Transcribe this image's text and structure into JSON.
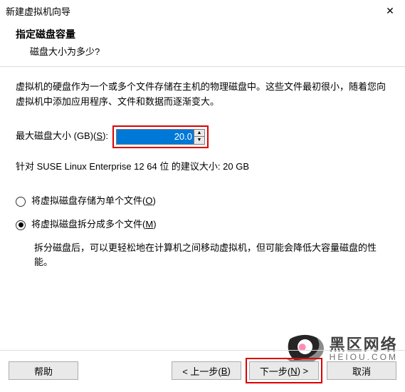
{
  "window": {
    "title": "新建虚拟机向导",
    "close": "✕"
  },
  "header": {
    "title": "指定磁盘容量",
    "sub": "磁盘大小为多少?"
  },
  "desc": "虚拟机的硬盘作为一个或多个文件存储在主机的物理磁盘中。这些文件最初很小，随着您向虚拟机中添加应用程序、文件和数据而逐渐变大。",
  "size": {
    "label_pre": "最大磁盘大小 (GB)(",
    "label_hk": "S",
    "label_post": "):",
    "value": "20.0",
    "spin_up": "▲",
    "spin_down": "▼"
  },
  "recommend": "针对 SUSE Linux Enterprise 12 64 位 的建议大小: 20 GB",
  "radios": {
    "single": {
      "label_pre": "将虚拟磁盘存储为单个文件(",
      "hk": "O",
      "label_post": ")"
    },
    "split": {
      "label_pre": "将虚拟磁盘拆分成多个文件(",
      "hk": "M",
      "label_post": ")"
    },
    "note": "拆分磁盘后，可以更轻松地在计算机之间移动虚拟机，但可能会降低大容量磁盘的性能。",
    "selected": "split"
  },
  "buttons": {
    "help": "帮助",
    "back_pre": "< 上一步(",
    "back_hk": "B",
    "back_post": ")",
    "next_pre": "下一步(",
    "next_hk": "N",
    "next_post": ") >",
    "cancel": "取消"
  },
  "watermark": {
    "l1": "黑区网络",
    "l2": "HEIOU.COM"
  }
}
